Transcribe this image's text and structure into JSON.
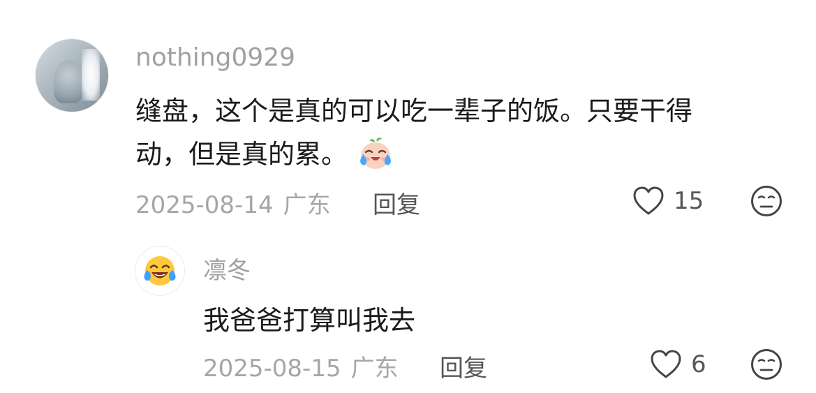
{
  "comment": {
    "username": "nothing0929",
    "content_line1": "缝盘，这个是真的可以吃一辈子的饭。只要干得",
    "content_line2": "动，但是真的累。",
    "emoji": "crying-laughing-face-emoji",
    "date": "2025-08-14",
    "location": "广东",
    "reply_label": "回复",
    "like_count": "15",
    "like_icon": "heart-outline-icon",
    "dislike_icon": "unamused-face-icon"
  },
  "reply": {
    "username": "凛冬",
    "avatar_icon": "tears-of-joy-emoji",
    "content": "我爸爸打算叫我去",
    "date": "2025-08-15",
    "location": "广东",
    "reply_label": "回复",
    "like_count": "6",
    "like_icon": "heart-outline-icon",
    "dislike_icon": "unamused-face-icon"
  },
  "colors": {
    "username": "#a0a0a0",
    "content": "#1a1a1a",
    "meta": "#a6a6a6",
    "action": "#555555"
  }
}
